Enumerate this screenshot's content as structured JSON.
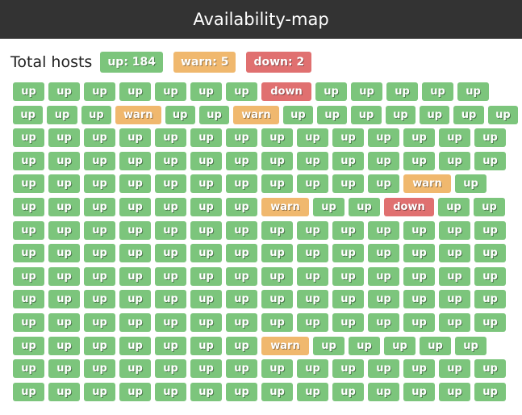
{
  "header": {
    "title": "Availability-map"
  },
  "summary": {
    "label": "Total hosts",
    "up_label": "up: 184",
    "warn_label": "warn: 5",
    "down_label": "down: 2"
  },
  "colors": {
    "up": "#7cc57c",
    "warn": "#f0b86e",
    "down": "#e07070"
  },
  "rows": [
    [
      "up",
      "up",
      "up",
      "up",
      "up",
      "up",
      "up",
      "down",
      "up",
      "up",
      "up",
      "up",
      "up"
    ],
    [
      "up",
      "up",
      "up",
      "warn",
      "up",
      "up",
      "warn",
      "up",
      "up",
      "up",
      "up",
      "up",
      "up",
      "up"
    ],
    [
      "up",
      "up",
      "up",
      "up",
      "up",
      "up",
      "up",
      "up",
      "up",
      "up",
      "up",
      "up",
      "up",
      "up"
    ],
    [
      "up",
      "up",
      "up",
      "up",
      "up",
      "up",
      "up",
      "up",
      "up",
      "up",
      "up",
      "up",
      "up",
      "up"
    ],
    [
      "up",
      "up",
      "up",
      "up",
      "up",
      "up",
      "up",
      "up",
      "up",
      "up",
      "up",
      "warn",
      "up"
    ],
    [
      "up",
      "up",
      "up",
      "up",
      "up",
      "up",
      "up",
      "warn",
      "up",
      "up",
      "down",
      "up",
      "up"
    ],
    [
      "up",
      "up",
      "up",
      "up",
      "up",
      "up",
      "up",
      "up",
      "up",
      "up",
      "up",
      "up",
      "up",
      "up"
    ],
    [
      "up",
      "up",
      "up",
      "up",
      "up",
      "up",
      "up",
      "up",
      "up",
      "up",
      "up",
      "up",
      "up",
      "up"
    ],
    [
      "up",
      "up",
      "up",
      "up",
      "up",
      "up",
      "up",
      "up",
      "up",
      "up",
      "up",
      "up",
      "up",
      "up"
    ],
    [
      "up",
      "up",
      "up",
      "up",
      "up",
      "up",
      "up",
      "up",
      "up",
      "up",
      "up",
      "up",
      "up",
      "up"
    ],
    [
      "up",
      "up",
      "up",
      "up",
      "up",
      "up",
      "up",
      "up",
      "up",
      "up",
      "up",
      "up",
      "up",
      "up"
    ],
    [
      "up",
      "up",
      "up",
      "up",
      "up",
      "up",
      "up",
      "warn",
      "up",
      "up",
      "up",
      "up",
      "up"
    ],
    [
      "up",
      "up",
      "up",
      "up",
      "up",
      "up",
      "up",
      "up",
      "up",
      "up",
      "up",
      "up",
      "up",
      "up"
    ],
    [
      "up",
      "up",
      "up",
      "up",
      "up",
      "up",
      "up",
      "up",
      "up",
      "up",
      "up",
      "up",
      "up",
      "up"
    ]
  ]
}
